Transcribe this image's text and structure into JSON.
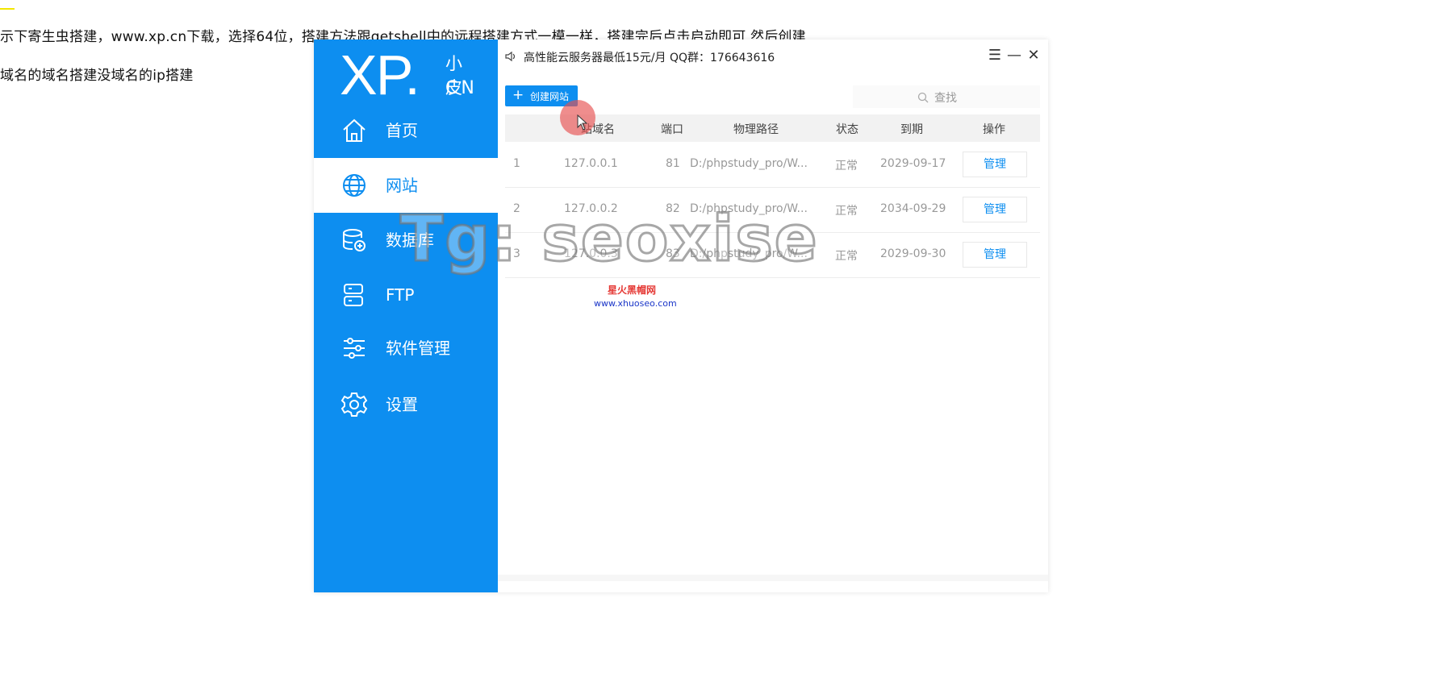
{
  "document": {
    "line1": "示下寄生虫搭建，www.xp.cn下载，选择64位，搭建方法跟getshell中的远程搭建方式一模一样，搭建完后点击启动即可 然后创建",
    "line2": "域名的域名搭建没域名的ip搭建"
  },
  "logo": {
    "main": "XP.",
    "cn_top": "小皮",
    "cn_bottom": "CN"
  },
  "sidebar": {
    "items": [
      {
        "label": "首页",
        "icon": "home-icon",
        "active": false
      },
      {
        "label": "网站",
        "icon": "globe-icon",
        "active": true
      },
      {
        "label": "数据库",
        "icon": "database-icon",
        "active": false
      },
      {
        "label": "FTP",
        "icon": "ftp-icon",
        "active": false
      },
      {
        "label": "软件管理",
        "icon": "sliders-icon",
        "active": false
      },
      {
        "label": "设置",
        "icon": "gear-icon",
        "active": false
      }
    ]
  },
  "topbar": {
    "notice": "高性能云服务器最低15元/月  QQ群：176643616"
  },
  "toolbar": {
    "create_label": "创建网站",
    "search_placeholder": "查找"
  },
  "table": {
    "headers": [
      "站域名",
      "端口",
      "物理路径",
      "状态",
      "到期",
      "操作"
    ],
    "rows": [
      {
        "num": "1",
        "domain": "127.0.0.1",
        "port": "81",
        "path": "D:/phpstudy_pro/W...",
        "status": "正常",
        "expire": "2029-09-17",
        "action": "管理"
      },
      {
        "num": "2",
        "domain": "127.0.0.2",
        "port": "82",
        "path": "D:/phpstudy_pro/W...",
        "status": "正常",
        "expire": "2034-09-29",
        "action": "管理"
      },
      {
        "num": "3",
        "domain": "127.0.0.3",
        "port": "83",
        "path": "D:/phpstudy_pro/W...",
        "status": "正常",
        "expire": "2029-09-30",
        "action": "管理"
      }
    ]
  },
  "watermark": {
    "text": "Tg: seoxise",
    "brand": "星火黑帽网",
    "url": "www.xhuoseo.com"
  },
  "colors": {
    "accent": "#0d8ef0"
  }
}
